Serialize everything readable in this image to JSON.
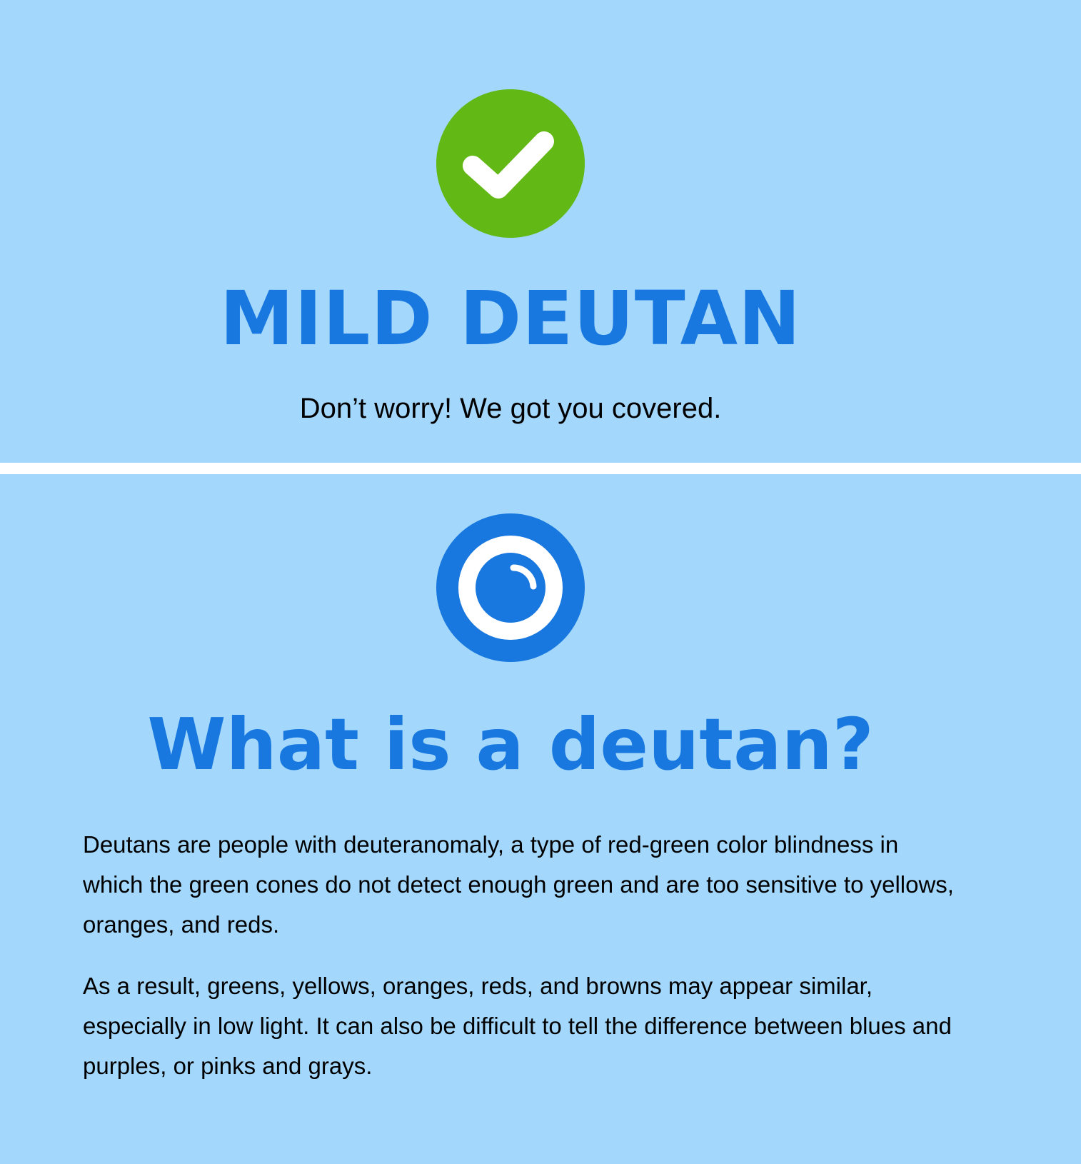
{
  "result": {
    "icon": "check-circle-icon",
    "icon_color": "#62b815",
    "title": "MILD DEUTAN",
    "subtitle": "Don’t worry! We got you covered."
  },
  "info": {
    "icon": "eye-icon",
    "icon_color": "#1878e0",
    "title": "What is a deutan?",
    "paragraphs": [
      "Deutans are people with deuteranomaly, a type of red-green color blindness in which the green cones do not detect enough green and are too sensitive to yellows, oranges, and reds.",
      "As a result, greens, yellows, oranges, reds, and browns may appear similar, especially in low light. It can also be difficult to tell the difference between blues and purples, or pinks and grays."
    ]
  },
  "colors": {
    "background": "#a3d8fc",
    "accent": "#1878e0",
    "divider": "#ffffff"
  }
}
